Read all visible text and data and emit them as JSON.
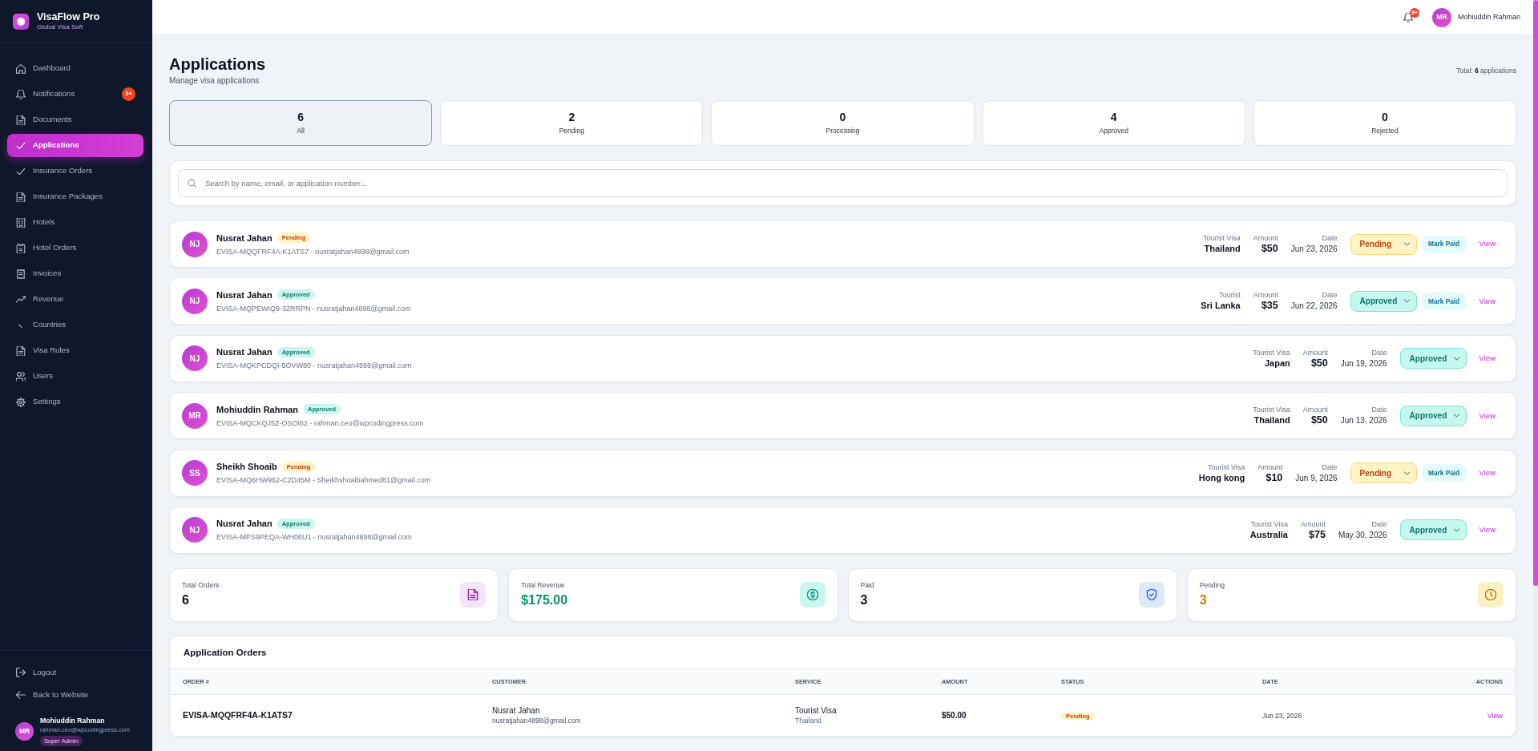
{
  "sidebar": {
    "brand": {
      "title": "VisaFlow Pro",
      "subtitle": "Global Visa Soft"
    },
    "nav": [
      {
        "label": "Dashboard",
        "selected": false
      },
      {
        "label": "Notifications",
        "selected": false,
        "badge": "9+"
      },
      {
        "label": "Documents",
        "selected": false
      },
      {
        "label": "Applications",
        "selected": true
      },
      {
        "label": "Insurance Orders",
        "selected": false
      },
      {
        "label": "Insurance Packages",
        "selected": false
      },
      {
        "label": "Hotels",
        "selected": false
      },
      {
        "label": "Hotel Orders",
        "selected": false
      },
      {
        "label": "Invoices",
        "selected": false
      },
      {
        "label": "Revenue",
        "selected": false
      },
      {
        "label": "Countries",
        "selected": false
      },
      {
        "label": "Visa Rules",
        "selected": false
      },
      {
        "label": "Users",
        "selected": false
      },
      {
        "label": "Settings",
        "selected": false
      }
    ],
    "footer_links": [
      "Logout",
      "Back to Website"
    ],
    "user": {
      "initials": "MR",
      "name": "Mohiuddin Rahman",
      "email": "rahman.ceo@wpcodingpress.com",
      "role": "Super Admin"
    }
  },
  "header": {
    "notification_badge": "9+",
    "user": {
      "initials": "MR",
      "name": "Mohiuddin Rahman"
    }
  },
  "page": {
    "title": "Applications",
    "subtitle": "Manage visa applications",
    "total": "Total: **6** applications"
  },
  "filters": [
    {
      "count": "6",
      "label": "All",
      "selected": true
    },
    {
      "count": "2",
      "label": "Pending",
      "selected": false
    },
    {
      "count": "0",
      "label": "Processing",
      "selected": false
    },
    {
      "count": "4",
      "label": "Approved",
      "selected": false
    },
    {
      "count": "0",
      "label": "Rejected",
      "selected": false
    }
  ],
  "search": {
    "placeholder": "Search by name, email, or application number..."
  },
  "applications": [
    {
      "initials": "NJ",
      "name": "Nusrat Jahan",
      "kind": "pending",
      "badge": "Pending",
      "details": "EVISA-MQQFRF4A-K1ATS7 - nusratjahan4898@gmail.com",
      "service": "Tourist Visa",
      "country": "Thailand",
      "amount_label": "Amount",
      "amount": "$50",
      "date_label": "Date",
      "date": "Jun 23, 2026",
      "status": "Pending",
      "mark_paid": "Mark Paid",
      "view": "View"
    },
    {
      "initials": "NJ",
      "name": "Nusrat Jahan",
      "kind": "approved",
      "badge": "Approved",
      "details": "EVISA-MQPEWIQ9-32RRPN - nusratjahan4898@gmail.com",
      "service": "Tourist",
      "country": "Sri Lanka",
      "amount_label": "Amount",
      "amount": "$35",
      "date_label": "Date",
      "date": "Jun 22, 2026",
      "status": "Approved",
      "mark_paid": "Mark Paid",
      "view": "View"
    },
    {
      "initials": "NJ",
      "name": "Nusrat Jahan",
      "kind": "approved",
      "badge": "Approved",
      "details": "EVISA-MQKPCDQI-5OVW80 - nusratjahan4898@gmail.com",
      "service": "Tourist Visa",
      "country": "Japan",
      "amount_label": "Amount",
      "amount": "$50",
      "date_label": "Date",
      "date": "Jun 19, 2026",
      "status": "Approved",
      "view": "View"
    },
    {
      "initials": "MR",
      "name": "Mohiuddin Rahman",
      "kind": "approved",
      "badge": "Approved",
      "details": "EVISA-MQCKQJ5Z-OSOI62 - rahman.ceo@wpcodingpress.com",
      "service": "Tourist Visa",
      "country": "Thailand",
      "amount_label": "Amount",
      "amount": "$50",
      "date_label": "Date",
      "date": "Jun 13, 2026",
      "status": "Approved",
      "view": "View"
    },
    {
      "initials": "SS",
      "name": "Sheikh Shoaib",
      "kind": "pending",
      "badge": "Pending",
      "details": "EVISA-MQ6HW962-C2D45M - Sheikhshoaibahmed81@gmail.com",
      "service": "Tourist Visa",
      "country": "Hong kong",
      "amount_label": "Amount",
      "amount": "$10",
      "date_label": "Date",
      "date": "Jun 9, 2026",
      "status": "Pending",
      "mark_paid": "Mark Paid",
      "view": "View"
    },
    {
      "initials": "NJ",
      "name": "Nusrat Jahan",
      "kind": "approved",
      "badge": "Approved",
      "details": "EVISA-MPS9PEQA-WH06U1 - nusratjahan4898@gmail.com",
      "service": "Tourist Visa",
      "country": "Australia",
      "amount_label": "Amount",
      "amount": "$75",
      "date_label": "Date",
      "date": "May 30, 2026",
      "status": "Approved",
      "view": "View"
    }
  ],
  "stats": [
    {
      "label": "Total Orders",
      "value": "6",
      "kind": "orders"
    },
    {
      "label": "Total Revenue",
      "value": "$175.00",
      "kind": "revenue"
    },
    {
      "label": "Paid",
      "value": "3",
      "kind": "paid"
    },
    {
      "label": "Pending",
      "value": "3",
      "kind": "pending"
    }
  ],
  "orders_table": {
    "title": "Application Orders",
    "columns": [
      "ORDER #",
      "CUSTOMER",
      "SERVICE",
      "AMOUNT",
      "STATUS",
      "DATE",
      "ACTIONS"
    ],
    "rows": [
      {
        "order": "EVISA-MQQFRF4A-K1ATS7",
        "customer": "Nusrat Jahan",
        "email": "nusratjahan4898@gmail.com",
        "service": "Tourist Visa",
        "country": "Thailand",
        "amount": "$50.00",
        "kind": "pending",
        "status": "Pending",
        "date": "Jun 23, 2026",
        "action": "View"
      }
    ]
  }
}
